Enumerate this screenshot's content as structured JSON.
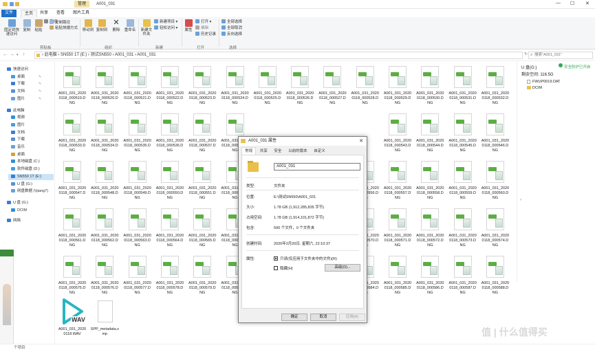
{
  "window": {
    "title": "A001_031",
    "context_tab": "管理",
    "controls": [
      "—",
      "☐",
      "✕"
    ]
  },
  "ribbon_tabs": [
    "文件",
    "主页",
    "共享",
    "查看",
    "图片工具"
  ],
  "ribbon": {
    "groups": {
      "clipboard": "剪贴板",
      "organize": "组织",
      "new": "新建",
      "open": "打开",
      "select": "选择"
    },
    "buttons": {
      "pin": "固定到快速访问",
      "copy": "复制",
      "paste": "粘贴",
      "cut": "剪切",
      "copy_path": "复制路径",
      "paste_shortcut": "粘贴快捷方式",
      "move_to": "移动到",
      "copy_to": "复制到",
      "delete": "删除",
      "rename": "重命名",
      "new_folder": "新建文件夹",
      "new_item": "新建项目",
      "easy_access": "轻松访问",
      "properties": "属性",
      "open": "打开",
      "edit": "编辑",
      "history": "历史记录",
      "select_all": "全部选择",
      "select_none": "全部取消",
      "invert": "反向选择"
    }
  },
  "address": {
    "path": "›  此电脑  ›  SN550 1T (E:)  ›  测试SN550  ›  A001_031  ›  A001_031",
    "search_placeholder": "搜索\"A001_031\""
  },
  "nav": [
    {
      "label": "快速访问",
      "level": 0
    },
    {
      "label": "桌面",
      "level": 1
    },
    {
      "label": "下载",
      "level": 1
    },
    {
      "label": "文档",
      "level": 1
    },
    {
      "label": "图片",
      "level": 1
    },
    {
      "label": "此电脑",
      "level": 0
    },
    {
      "label": "视频",
      "level": 1
    },
    {
      "label": "图片",
      "level": 1
    },
    {
      "label": "文档",
      "level": 1
    },
    {
      "label": "下载",
      "level": 1
    },
    {
      "label": "音乐",
      "level": 1
    },
    {
      "label": "桌面",
      "level": 1
    },
    {
      "label": "本地磁盘 (C:)",
      "level": 1
    },
    {
      "label": "软件磁盘 (D:)",
      "level": 1
    },
    {
      "label": "SN550 1T (E:)",
      "level": 1
    },
    {
      "label": "U 盘 (G:)",
      "level": 1
    },
    {
      "label": "网盘数据 (\\\\jiang7)",
      "level": 1
    },
    {
      "label": "U 盘 (G:)",
      "level": 0
    },
    {
      "label": "DCIM",
      "level": 1
    },
    {
      "label": "网络",
      "level": 0
    }
  ],
  "files": {
    "row1": [
      "A001_031_2020\n0118_000519.D\nNG",
      "A001_031_2020\n0118_000520.D\nNG",
      "A001_031_2020\n0118_000521.D\nNG",
      "A001_031_2020\n0118_000522.D\nNG",
      "A001_031_2020\n0118_000523.D\nNG",
      "A001_031_2020\n0118_000524.D\nNG",
      "A001_031_2020\n0118_000525.D\nNG",
      "A001_031_2020\n0118_000526.D\nNG",
      "A001_031_2020\n0118_000527.D\nNG",
      "A001_031_2020\n0118_000528.D\nNG",
      "A001_031_2020\n0118_000529.D\nNG",
      "A001_031_2020\n0118_000530.D\nNG",
      "A001_031_2020\n0118_000531.D\nNG",
      "A001_031_2020\n0118_000532.D\nNG"
    ],
    "row2": [
      "A001_031_2020\n0118_000533.D\nNG",
      "A001_031_2020\n0118_000534.D\nNG",
      "A001_031_2020\n0118_000535.D\nNG",
      "A001_031_2020\n0118_000536.D\nNG",
      "A001_031_2020\n0118_000537.D\nNG",
      "A001_031_2020\n0118_000538.D\nNG",
      "",
      "",
      "",
      "",
      "A001_031_2020\n0118_000543.D\nNG",
      "A001_031_2020\n0118_000544.D\nNG",
      "A001_031_2020\n0118_000545.D\nNG",
      "A001_031_2020\n0118_000546.D\nNG"
    ],
    "row3": [
      "A001_031_2020\n0118_000547.D\nNG",
      "A001_031_2020\n0118_000548.D\nNG",
      "A001_031_2020\n0118_000549.D\nNG",
      "A001_031_2020\n0118_000550.D\nNG",
      "A001_031_2020\n0118_000551.D\nNG",
      "A001_031_2020\n0118_000552.D\nNG",
      "",
      "",
      "",
      "A001_031_2020\n0118_000556.D\nNG",
      "A001_031_2020\n0118_000557.D\nNG",
      "A001_031_2020\n0118_000558.D\nNG",
      "A001_031_2020\n0118_000559.D\nNG",
      "A001_031_2020\n0118_000560.D\nNG"
    ],
    "row4": [
      "A001_031_2020\n0118_000561.D\nNG",
      "A001_031_2020\n0118_000562.D\nNG",
      "A001_031_2020\n0118_000563.D\nNG",
      "A001_031_2020\n0118_000564.D\nNG",
      "A001_031_2020\n0118_000565.D\nNG",
      "A001_031_2020\n0118_000566.D\nNG",
      "",
      "",
      "",
      "A001_031_2020\n0118_000570.D\nNG",
      "A001_031_2020\n0118_000571.D\nNG",
      "A001_031_2020\n0118_000572.D\nNG",
      "A001_031_2020\n0118_000573.D\nNG",
      "A001_031_2020\n0118_000574.D\nNG"
    ],
    "row5": [
      "A001_031_2020\n0118_000575.D\nNG",
      "A001_031_2020\n0118_000576.D\nNG",
      "A001_031_2020\n0118_000577.D\nNG",
      "A001_031_2020\n0118_000578.D\nNG",
      "A001_031_2020\n0118_000579.D\nNG",
      "A001_031_2020\n0118_000580.D\nNG",
      "",
      "",
      "",
      "A001_031_2020\n0118_000584.D\nNG",
      "A001_031_2020\n0118_000585.D\nNG",
      "A001_031_2020\n0118_000586.D\nNG",
      "A001_031_2020\n0118_000587.D\nNG",
      "A001_031_2020\n0118_000588.D\nNG"
    ],
    "extra": [
      {
        "name": "A001_031_2020\n0118.WAV",
        "badge": "WAV",
        "kind": "wav"
      },
      {
        "name": "SPP_metadata.x\nmp",
        "kind": "doc"
      }
    ]
  },
  "detail": {
    "drive": "U 盘(G:)",
    "free": "剩余空间: 116.5G",
    "security_link": "安全防护已开启",
    "items": [
      "FWUP0019.DAT",
      "DCIM"
    ]
  },
  "status": "个项目",
  "dialog": {
    "title": "A001_031 属性",
    "tabs": [
      "常规",
      "共享",
      "安全",
      "以前的版本",
      "自定义"
    ],
    "name_value": "A001_031",
    "rows": [
      {
        "label": "类型:",
        "value": "文件夹"
      },
      {
        "label": "位置:",
        "value": "E:\\测试SN550\\A001_031"
      },
      {
        "label": "大小:",
        "value": "1.78 GB (1,912,285,835 字节)"
      },
      {
        "label": "占用空间:",
        "value": "1.78 GB (1,914,101,872 字节)"
      },
      {
        "label": "包含:",
        "value": "590 个文件，0 个文件夹"
      },
      {
        "label": "创建时间:",
        "value": "2020年2月26日, 星期六, 22:10:37"
      },
      {
        "label": "属性:",
        "value": ""
      }
    ],
    "readonly_label": "只读(仅应用于文件夹中的文件)(R)",
    "hidden_label": "隐藏(H)",
    "advanced_button": "高级(D)...",
    "ok_button": "确定",
    "cancel_button": "取消",
    "apply_button": "应用(A)"
  },
  "watermark": "值 | 什么值得买",
  "colors": {
    "accent": "#1e6fc9",
    "tag_green": "#5cae44",
    "context_tab": "#f4e3a4"
  }
}
